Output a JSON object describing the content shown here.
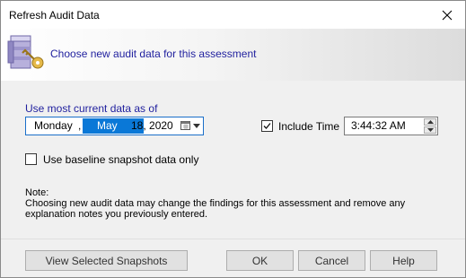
{
  "window": {
    "title": "Refresh Audit Data"
  },
  "header": {
    "text": "Choose new audit data for this assessment"
  },
  "date_section": {
    "label": "Use most current data as of",
    "day": "Monday",
    "comma": ",",
    "month": "May",
    "rest": "18, 2020"
  },
  "include_time": {
    "checked": true,
    "label": "Include Time",
    "time_value": "3:44:32 AM"
  },
  "baseline": {
    "checked": false,
    "label": "Use baseline snapshot data only"
  },
  "note": {
    "heading": "Note:",
    "line1": "Choosing new audit data may change the findings for this assessment and remove any",
    "line2": "explanation notes you previously entered."
  },
  "buttons": {
    "view_snapshots": "View Selected Snapshots",
    "ok": "OK",
    "cancel": "Cancel",
    "help": "Help"
  },
  "icons": {
    "close": "close-icon",
    "header": "database-key-icon",
    "calendar": "calendar-icon",
    "dropdown": "chevron-down-icon",
    "spin_up": "spin-up-icon",
    "spin_down": "spin-down-icon"
  },
  "colors": {
    "accent": "#0a78d7",
    "label_blue": "#1f1f9e"
  }
}
